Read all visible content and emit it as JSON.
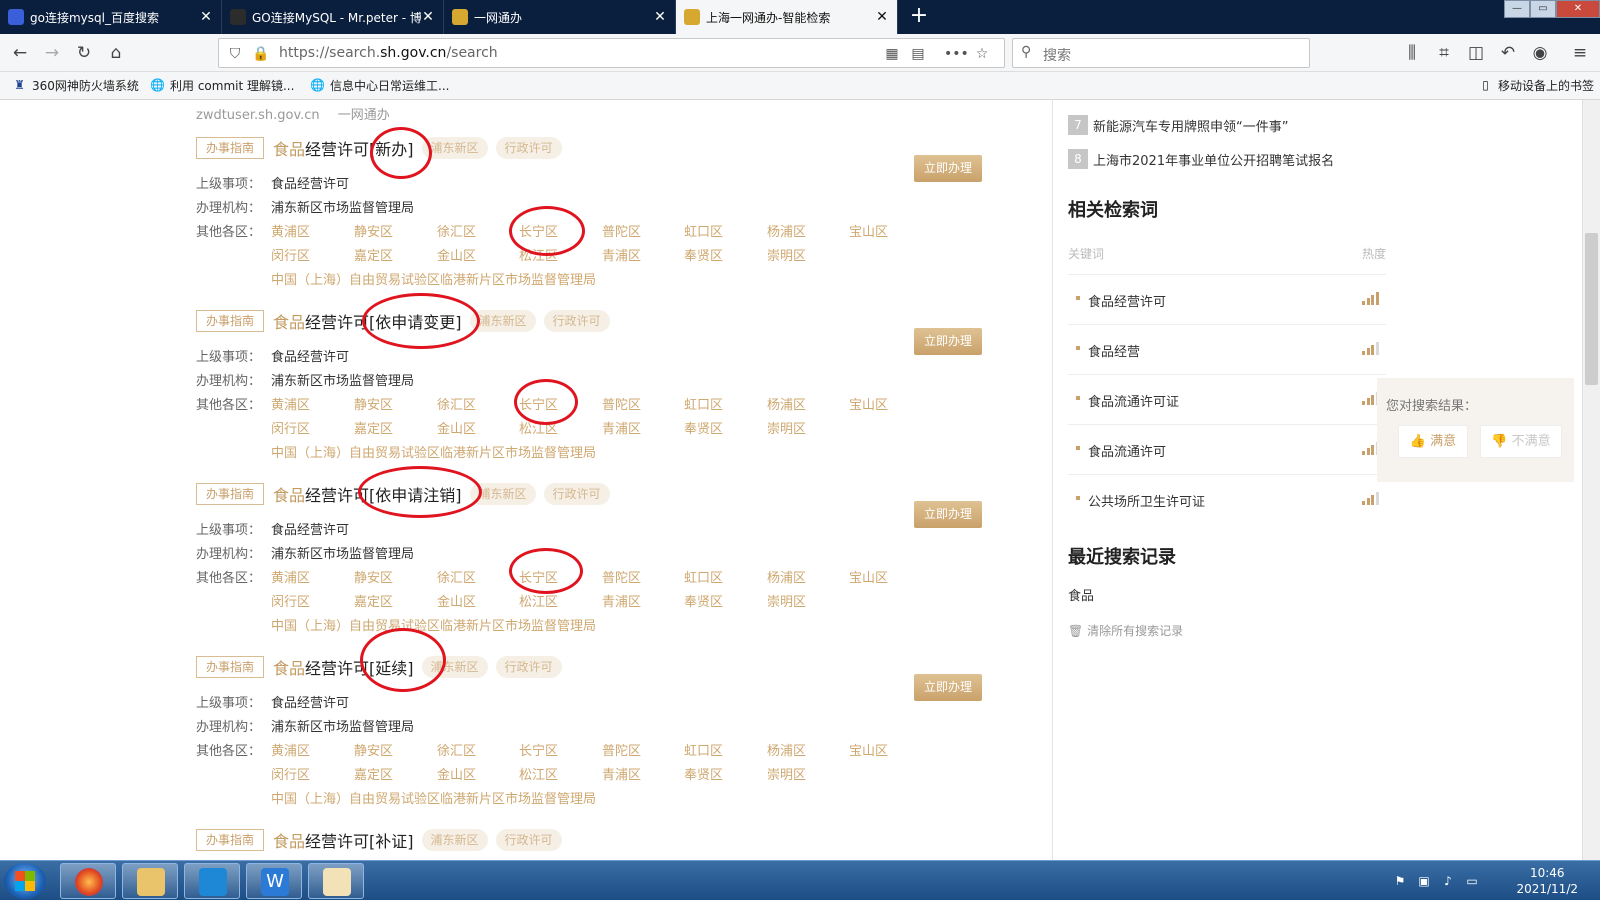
{
  "tabs": [
    {
      "title": "go连接mysql_百度搜索",
      "close": "✕"
    },
    {
      "title": "GO连接MySQL - Mr.peter - 博客园",
      "close": "✕"
    },
    {
      "title": "一网通办",
      "close": "✕"
    },
    {
      "title": "上海一网通办-智能检索",
      "close": "✕"
    }
  ],
  "new_tab": "+",
  "window_controls": {
    "minimize": "—",
    "maximize": "▭",
    "close": "✕"
  },
  "url": {
    "prefix": "https://search.",
    "domain": "sh.gov.cn",
    "path": "/search"
  },
  "search": {
    "placeholder": "搜索"
  },
  "bookmarks": [
    "360网神防火墙系统",
    "利用 commit 理解镜...",
    "信息中心日常运维工..."
  ],
  "mobile_bookmarks": "移动设备上的书签",
  "source_line": {
    "site": "zwdtuser.sh.gov.cn",
    "name": "一网通办"
  },
  "results": [
    {
      "tag": "办事指南",
      "title_hl": "食品",
      "title_rest": "经营许可[新办]",
      "pill_area": "浦东新区",
      "pill_type": "行政许可",
      "apply": "立即办理",
      "parent_label": "上级事项：",
      "parent": "食品经营许可",
      "org_label": "办理机构：",
      "org": "浦东新区市场监督管理局",
      "other_label": "其他各区："
    },
    {
      "tag": "办事指南",
      "title_hl": "食品",
      "title_rest": "经营许可[依申请变更]",
      "pill_area": "浦东新区",
      "pill_type": "行政许可",
      "apply": "立即办理",
      "parent_label": "上级事项：",
      "parent": "食品经营许可",
      "org_label": "办理机构：",
      "org": "浦东新区市场监督管理局",
      "other_label": "其他各区："
    },
    {
      "tag": "办事指南",
      "title_hl": "食品",
      "title_rest": "经营许可[依申请注销]",
      "pill_area": "浦东新区",
      "pill_type": "行政许可",
      "apply": "立即办理",
      "parent_label": "上级事项：",
      "parent": "食品经营许可",
      "org_label": "办理机构：",
      "org": "浦东新区市场监督管理局",
      "other_label": "其他各区："
    },
    {
      "tag": "办事指南",
      "title_hl": "食品",
      "title_rest": "经营许可[延续]",
      "pill_area": "浦东新区",
      "pill_type": "行政许可",
      "apply": "立即办理",
      "parent_label": "上级事项：",
      "parent": "食品经营许可",
      "org_label": "办理机构：",
      "org": "浦东新区市场监督管理局",
      "other_label": "其他各区："
    },
    {
      "tag": "办事指南",
      "title_hl": "食品",
      "title_rest": "经营许可[补证]",
      "pill_area": "浦东新区",
      "pill_type": "行政许可"
    }
  ],
  "districts": [
    "黄浦区",
    "静安区",
    "徐汇区",
    "长宁区",
    "普陀区",
    "虹口区",
    "杨浦区",
    "宝山区",
    "闵行区",
    "嘉定区",
    "金山区",
    "松江区",
    "青浦区",
    "奉贤区",
    "崇明区"
  ],
  "district_ftz": "中国（上海）自由贸易试验区临港新片区市场监督管理局",
  "hot_items": [
    {
      "rank": "7",
      "text": "新能源汽车专用牌照申领“一件事”"
    },
    {
      "rank": "8",
      "text": "上海市2021年事业单位公开招聘笔试报名"
    }
  ],
  "related": {
    "title": "相关检索词",
    "col_keyword": "关键词",
    "col_heat": "热度",
    "items": [
      "食品经营许可",
      "食品经营",
      "食品流通许可证",
      "食品流通许可",
      "公共场所卫生许可证"
    ]
  },
  "feedback": {
    "question": "您对搜索结果：",
    "yes": "满意",
    "no": "不满意"
  },
  "recent": {
    "title": "最近搜索记录",
    "items": [
      "食品"
    ],
    "clear": "清除所有搜索记录"
  },
  "clock": {
    "time": "10:46",
    "date": "2021/11/2"
  },
  "colors": {
    "accent": "#c9a06b",
    "annotation": "#e0141f",
    "tab_bg": "#0a1e3e"
  }
}
